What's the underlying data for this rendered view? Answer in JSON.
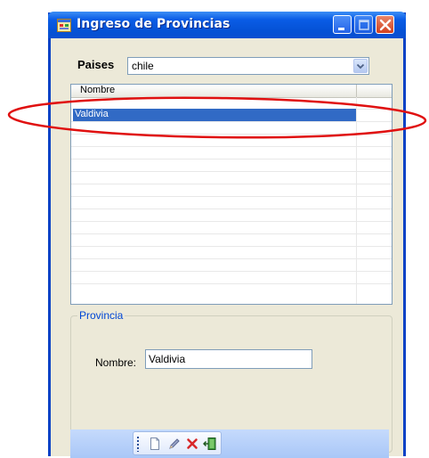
{
  "window": {
    "title": "Ingreso de Provincias",
    "icon": "form-app-icon"
  },
  "title_buttons": [
    "minimize-icon",
    "maximize-icon",
    "close-icon"
  ],
  "paises": {
    "label": "Paises",
    "selected": "chile"
  },
  "grid": {
    "header": "Nombre",
    "rows": [
      "Valdivia"
    ]
  },
  "provincia": {
    "group_title": "Provincia",
    "nombre_label": "Nombre:",
    "nombre_value": "Valdivia"
  },
  "toolbar": {
    "tools": [
      "new-document-icon",
      "edit-pencil-icon",
      "delete-x-icon",
      "exit-door-icon"
    ]
  },
  "annotation": {
    "color": "#e01010"
  }
}
